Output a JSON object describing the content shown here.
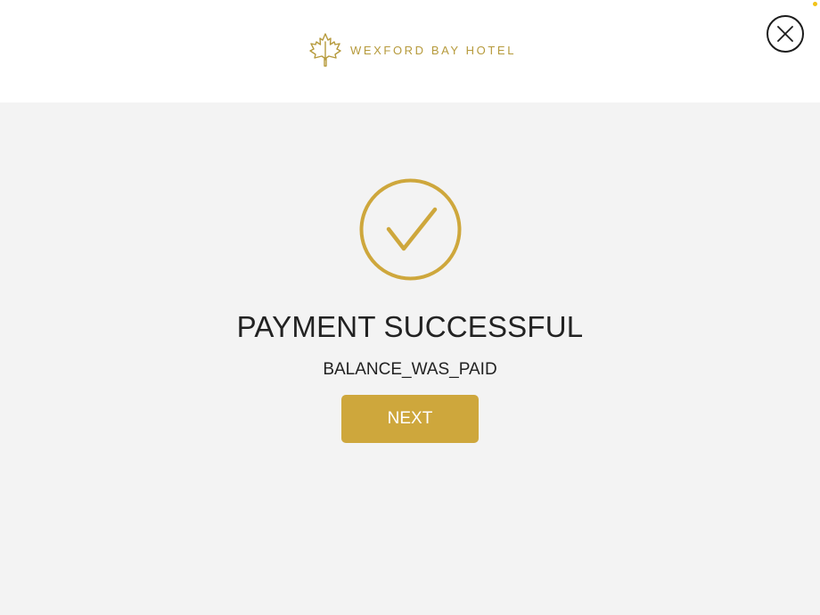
{
  "header": {
    "brand_name": "WEXFORD BAY HOTEL",
    "logo_icon": "maple-leaf-icon",
    "close_icon": "close-icon",
    "close_label": "Close"
  },
  "main": {
    "status_icon": "check-circle-icon",
    "title": "PAYMENT SUCCESSFUL",
    "message": "BALANCE_WAS_PAID",
    "next_label": "NEXT"
  },
  "colors": {
    "accent": "#cea73c",
    "brand_text": "#b69a3c",
    "header_bg": "#ffffff",
    "page_bg": "#f3f3f3",
    "text": "#222222",
    "close_border": "#1c1c1c"
  }
}
